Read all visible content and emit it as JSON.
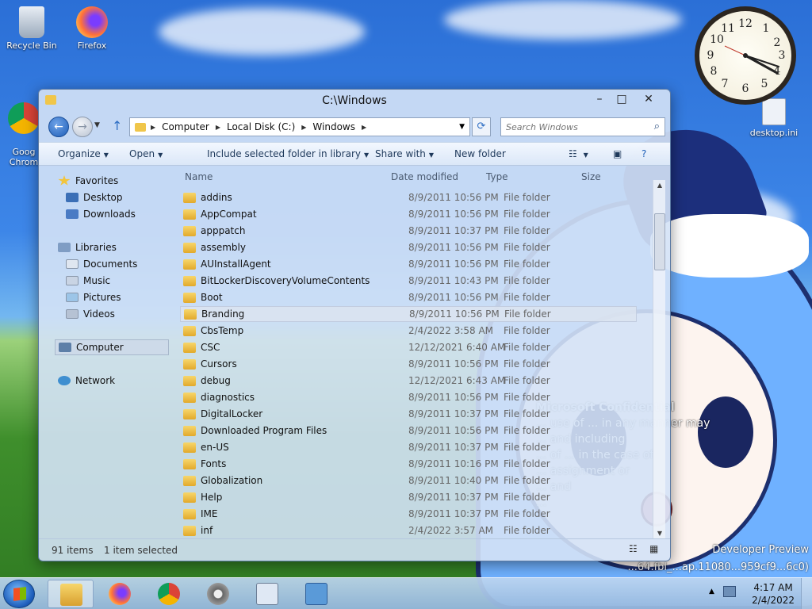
{
  "desktop": {
    "icons": [
      {
        "label": "Recycle Bin"
      },
      {
        "label": "Firefox"
      },
      {
        "label": "Goog\nChrom"
      },
      {
        "label": "desktop.ini"
      }
    ],
    "watermark": {
      "title": "Microsoft Confidential",
      "lines": [
        "... use of ... in any manner may",
        "... and including",
        "... of ... in the case of",
        "... assignment or",
        "... and",
        "..."
      ]
    },
    "build_lines": [
      "Developer Preview",
      "...64.fbl_...ap.11080...959cf9...6c0)"
    ]
  },
  "clock": {
    "numbers": [
      "12",
      "1",
      "2",
      "3",
      "4",
      "5",
      "6",
      "7",
      "8",
      "9",
      "10",
      "11"
    ]
  },
  "window": {
    "title": "C:\\Windows",
    "controls": {
      "minimize": "–",
      "maximize": "□",
      "close": "✕"
    },
    "breadcrumb": [
      "Computer",
      "Local Disk (C:)",
      "Windows"
    ],
    "search_placeholder": "Search Windows",
    "toolbar": {
      "organize": "Organize",
      "open": "Open",
      "include": "Include selected folder in library",
      "share": "Share with",
      "new_folder": "New folder"
    },
    "nav": {
      "favorites": "Favorites",
      "desktop": "Desktop",
      "downloads": "Downloads",
      "libraries": "Libraries",
      "documents": "Documents",
      "music": "Music",
      "pictures": "Pictures",
      "videos": "Videos",
      "computer": "Computer",
      "network": "Network"
    },
    "columns": {
      "name": "Name",
      "date": "Date modified",
      "type": "Type",
      "size": "Size"
    },
    "files": [
      {
        "name": "addins",
        "date": "8/9/2011 10:56 PM",
        "type": "File folder"
      },
      {
        "name": "AppCompat",
        "date": "8/9/2011 10:56 PM",
        "type": "File folder"
      },
      {
        "name": "apppatch",
        "date": "8/9/2011 10:37 PM",
        "type": "File folder"
      },
      {
        "name": "assembly",
        "date": "8/9/2011 10:56 PM",
        "type": "File folder"
      },
      {
        "name": "AUInstallAgent",
        "date": "8/9/2011 10:56 PM",
        "type": "File folder"
      },
      {
        "name": "BitLockerDiscoveryVolumeContents",
        "date": "8/9/2011 10:43 PM",
        "type": "File folder"
      },
      {
        "name": "Boot",
        "date": "8/9/2011 10:56 PM",
        "type": "File folder"
      },
      {
        "name": "Branding",
        "date": "8/9/2011 10:56 PM",
        "type": "File folder"
      },
      {
        "name": "CbsTemp",
        "date": "2/4/2022 3:58 AM",
        "type": "File folder"
      },
      {
        "name": "CSC",
        "date": "12/12/2021 6:40 AM",
        "type": "File folder"
      },
      {
        "name": "Cursors",
        "date": "8/9/2011 10:56 PM",
        "type": "File folder"
      },
      {
        "name": "debug",
        "date": "12/12/2021 6:43 AM",
        "type": "File folder"
      },
      {
        "name": "diagnostics",
        "date": "8/9/2011 10:56 PM",
        "type": "File folder"
      },
      {
        "name": "DigitalLocker",
        "date": "8/9/2011 10:37 PM",
        "type": "File folder"
      },
      {
        "name": "Downloaded Program Files",
        "date": "8/9/2011 10:56 PM",
        "type": "File folder"
      },
      {
        "name": "en-US",
        "date": "8/9/2011 10:37 PM",
        "type": "File folder"
      },
      {
        "name": "Fonts",
        "date": "8/9/2011 10:16 PM",
        "type": "File folder"
      },
      {
        "name": "Globalization",
        "date": "8/9/2011 10:40 PM",
        "type": "File folder"
      },
      {
        "name": "Help",
        "date": "8/9/2011 10:37 PM",
        "type": "File folder"
      },
      {
        "name": "IME",
        "date": "8/9/2011 10:37 PM",
        "type": "File folder"
      },
      {
        "name": "inf",
        "date": "2/4/2022 3:57 AM",
        "type": "File folder"
      }
    ],
    "selected_file": "Branding",
    "status": {
      "items": "91 items",
      "selected": "1 item selected"
    }
  },
  "taskbar": {
    "apps": [
      "file-explorer",
      "firefox",
      "chrome",
      "settings",
      "resource-monitor",
      "remote-desktop"
    ],
    "time": "4:17 AM",
    "date": "2/4/2022"
  }
}
